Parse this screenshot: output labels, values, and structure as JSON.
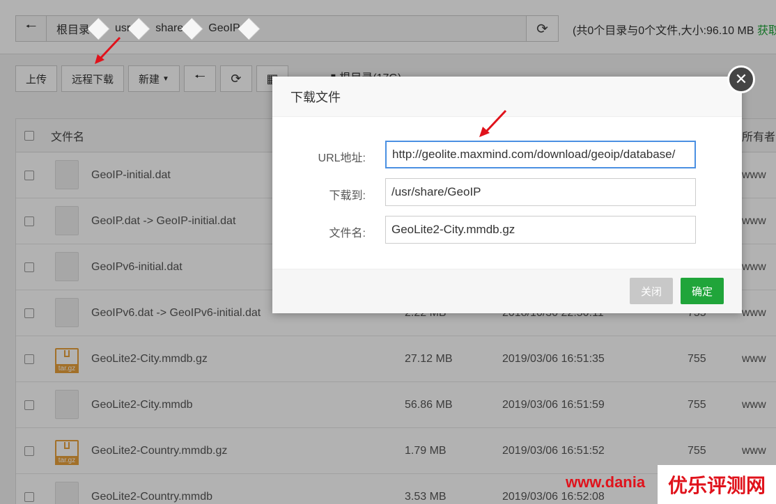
{
  "breadcrumb": {
    "segments": [
      "根目录",
      "usr",
      "share",
      "GeoIP"
    ],
    "info": "(共0个目录与0个文件,大小:96.10 MB",
    "info_link": "获取"
  },
  "toolbar": {
    "upload": "上传",
    "remote_download": "远程下载",
    "new": "新建",
    "dir_size": "根目录(17G)"
  },
  "table": {
    "headers": {
      "name": "文件名",
      "owner": "所有者"
    },
    "rows": [
      {
        "name": "GeoIP-initial.dat",
        "size": "",
        "date": "",
        "perm": "",
        "owner": "www",
        "type": "file"
      },
      {
        "name": "GeoIP.dat -> GeoIP-initial.dat",
        "size": "",
        "date": "",
        "perm": "",
        "owner": "www",
        "type": "file"
      },
      {
        "name": "GeoIPv6-initial.dat",
        "size": "",
        "date": "",
        "perm": "",
        "owner": "www",
        "type": "file"
      },
      {
        "name": "GeoIPv6.dat -> GeoIPv6-initial.dat",
        "size": "2.22 MB",
        "date": "2018/10/30 22:50:11",
        "perm": "755",
        "owner": "www",
        "type": "file"
      },
      {
        "name": "GeoLite2-City.mmdb.gz",
        "size": "27.12 MB",
        "date": "2019/03/06 16:51:35",
        "perm": "755",
        "owner": "www",
        "type": "tar"
      },
      {
        "name": "GeoLite2-City.mmdb",
        "size": "56.86 MB",
        "date": "2019/03/06 16:51:59",
        "perm": "755",
        "owner": "www",
        "type": "file"
      },
      {
        "name": "GeoLite2-Country.mmdb.gz",
        "size": "1.79 MB",
        "date": "2019/03/06 16:51:52",
        "perm": "755",
        "owner": "www",
        "type": "tar"
      },
      {
        "name": "GeoLite2-Country.mmdb",
        "size": "3.53 MB",
        "date": "2019/03/06 16:52:08",
        "perm": "755",
        "owner": "www",
        "type": "file"
      }
    ]
  },
  "modal": {
    "title": "下载文件",
    "url_label": "URL地址:",
    "url_value": "http://geolite.maxmind.com/download/geoip/database/",
    "dest_label": "下载到:",
    "dest_value": "/usr/share/GeoIP",
    "filename_label": "文件名:",
    "filename_value": "GeoLite2-City.mmdb.gz",
    "close_label": "关闭",
    "ok_label": "确定"
  },
  "watermark": {
    "url": "www.dania",
    "name": "优乐评测网"
  },
  "icons": {
    "back": "arrow-left-icon",
    "refresh": "refresh-icon",
    "close": "close-icon"
  },
  "colors": {
    "accent_green": "#20a53a",
    "annotation_red": "#e0121b"
  }
}
